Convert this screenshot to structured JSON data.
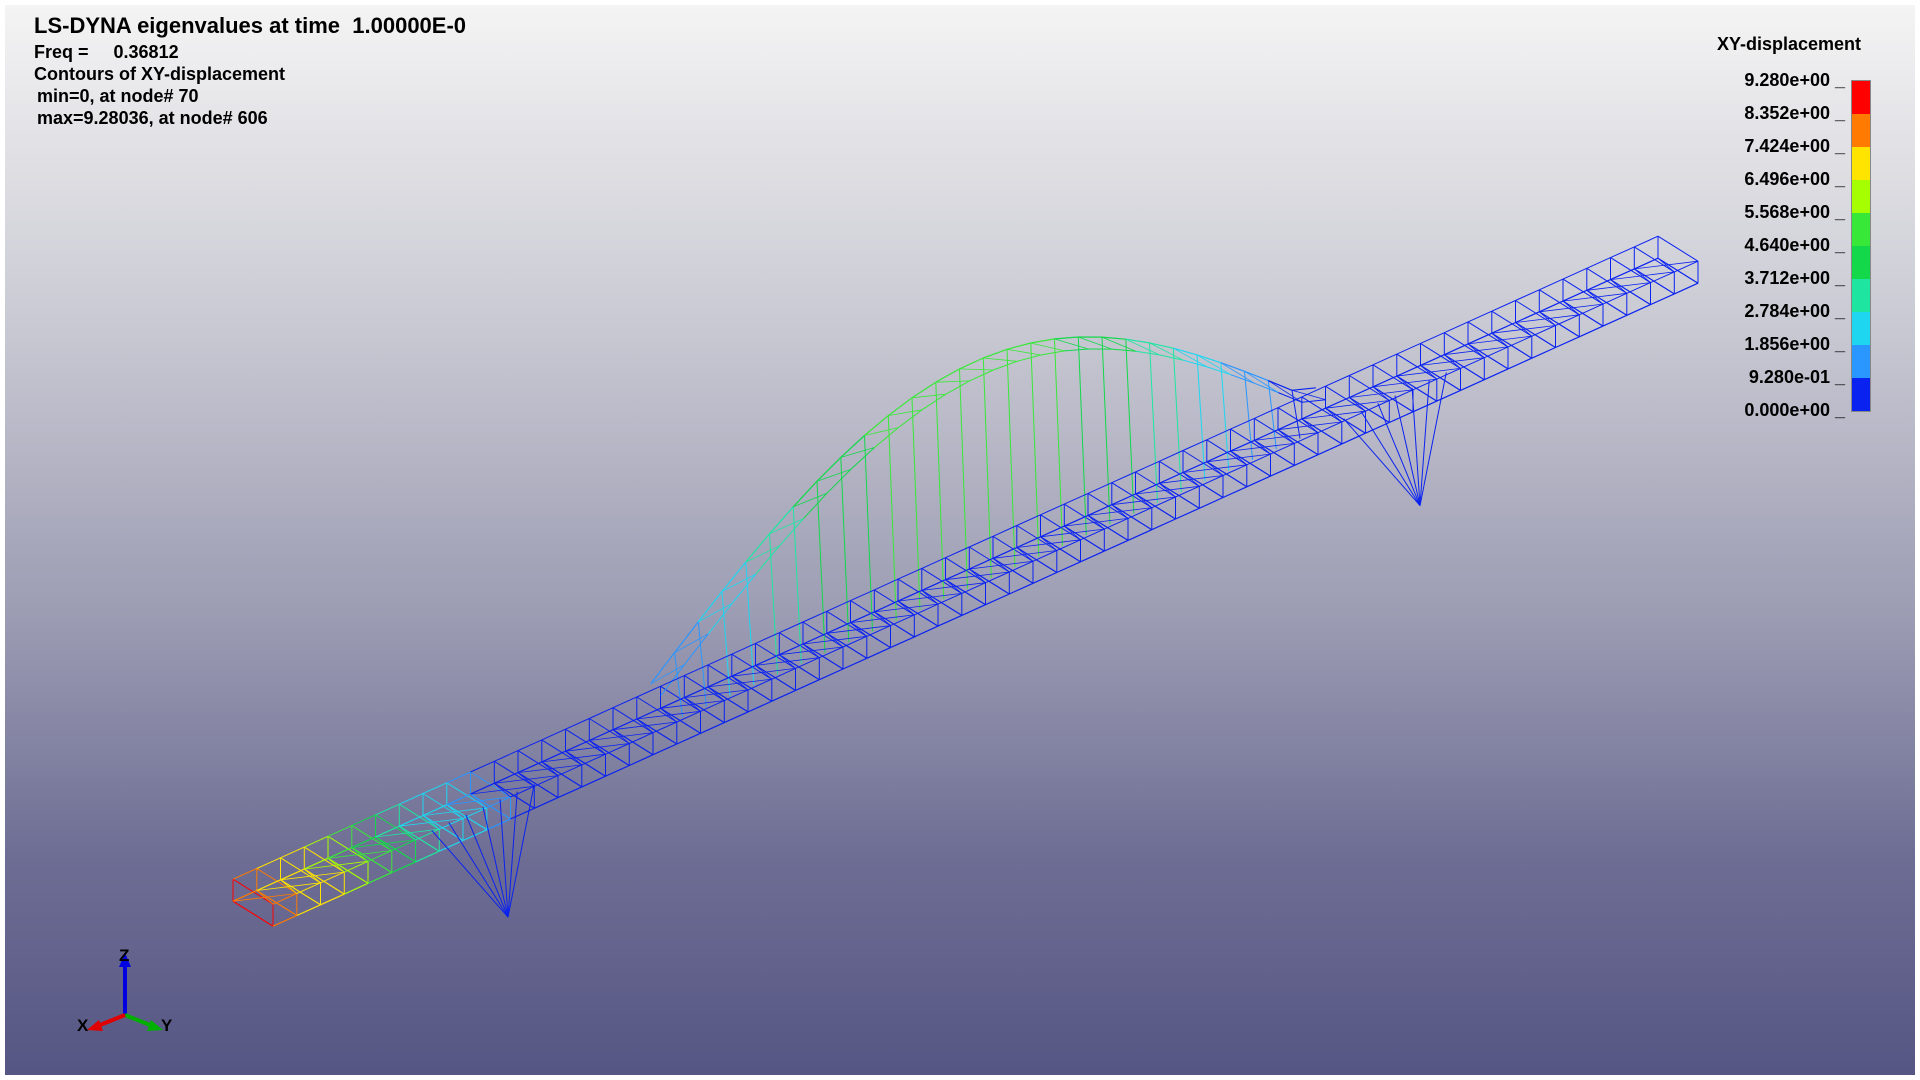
{
  "header": {
    "title": "LS-DYNA eigenvalues at time  1.00000E-0",
    "freq_line": "Freq =     0.36812",
    "contour_line": "Contours of XY-displacement",
    "min_line": "min=0, at node# 70",
    "max_line": "max=9.28036, at node# 606"
  },
  "legend": {
    "title": "XY-displacement",
    "labels": [
      "9.280e+00",
      "8.352e+00",
      "7.424e+00",
      "6.496e+00",
      "5.568e+00",
      "4.640e+00",
      "3.712e+00",
      "2.784e+00",
      "1.856e+00",
      "9.280e-01",
      "0.000e+00"
    ],
    "colors": [
      "#ff0000",
      "#ff7a00",
      "#ffe400",
      "#a6ff00",
      "#38e838",
      "#12d84a",
      "#1ee6a0",
      "#1ed6f0",
      "#2a96ff",
      "#0a22f0"
    ]
  },
  "mesh": {
    "color_high": "#ff0000",
    "color_low": "#0010e0"
  },
  "triad": {
    "x_label": "X",
    "y_label": "Y",
    "z_label": "Z",
    "x_color": "#e00000",
    "y_color": "#00b000",
    "z_color": "#0000e0"
  }
}
